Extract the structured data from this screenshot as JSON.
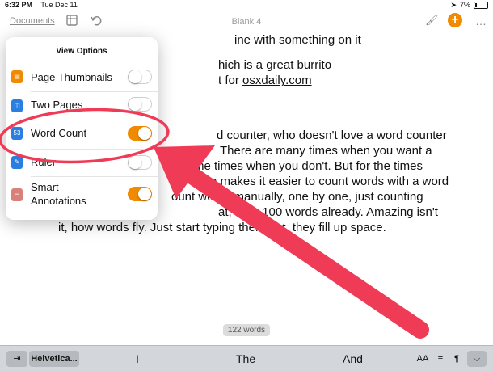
{
  "status_bar": {
    "time": "6:32 PM",
    "date": "Tue Dec 11",
    "battery": "7%"
  },
  "toolbar": {
    "documents_label": "Documents",
    "doc_title": "Blank 4",
    "plus_label": "+",
    "more_label": "…"
  },
  "document": {
    "line1_tail": "ine with something on it",
    "line2_tail": "hich is a great burrito",
    "line3_tail": "t for",
    "line3_link": "osxdaily.com",
    "para": [
      "d counter, who doesn't love a word counter",
      "There are many times when you want a",
      "me times when you don't. But for the times",
      "e makes it easier to count words with a word",
      "ount words manually, one by one, just counting",
      "at, over 100 words already. Amazing isn't",
      "it, how words fly. Just start typing them out, they fill up space."
    ]
  },
  "word_count_badge": "122 words",
  "keyboard_bar": {
    "tab_key": "⇥",
    "font_key": "Helvetica...",
    "suggestions": [
      "I",
      "The",
      "And"
    ],
    "size_key": "AA",
    "align_key": "≡",
    "indent_key": "¶",
    "hide_key": "⌵"
  },
  "view_options": {
    "title": "View Options",
    "items": [
      {
        "label": "Page Thumbnails",
        "icon": "page-thumbnails-icon",
        "icon_color": "#f08a00",
        "enabled": false
      },
      {
        "label": "Two Pages",
        "icon": "two-pages-icon",
        "icon_color": "#2a7de1",
        "enabled": false
      },
      {
        "label": "Word Count",
        "icon": "word-count-icon",
        "icon_glyph": "53",
        "icon_color": "#2a7de1",
        "enabled": true
      },
      {
        "label": "Ruler",
        "icon": "ruler-icon",
        "icon_color": "#2a7de1",
        "enabled": false
      },
      {
        "label": "Smart",
        "label2": "Annotations",
        "icon": "smart-annotations-icon",
        "icon_color": "#d9807a",
        "enabled": true
      }
    ]
  },
  "annotation": {
    "color": "#ef3b55"
  }
}
